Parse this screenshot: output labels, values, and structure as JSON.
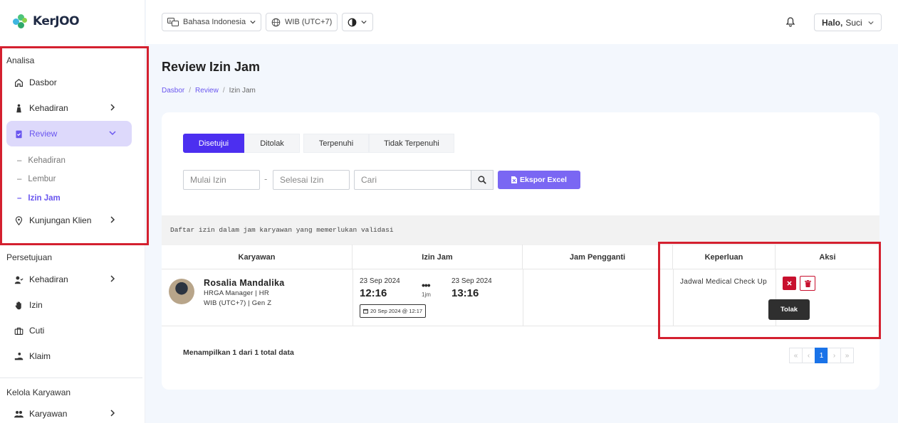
{
  "brand": {
    "logo_text": "KerJOO"
  },
  "sidebar": {
    "analisa_title": "Analisa",
    "dasbor": "Dasbor",
    "kehadiran": "Kehadiran",
    "review": "Review",
    "review_sub": [
      "Kehadiran",
      "Lembur",
      "Izin Jam"
    ],
    "kunjungan": "Kunjungan Klien",
    "persetujuan_title": "Persetujuan",
    "p_kehadiran": "Kehadiran",
    "p_izin": "Izin",
    "p_cuti": "Cuti",
    "p_klaim": "Klaim",
    "kelola_title": "Kelola Karyawan",
    "k_karyawan": "Karyawan"
  },
  "topbar": {
    "language": "Bahasa Indonesia",
    "timezone": "WIB (UTC+7)",
    "greeting": "Halo,",
    "user": "Suci"
  },
  "page": {
    "title": "Review Izin Jam",
    "breadcrumb": [
      "Dasbor",
      "Review",
      "Izin Jam"
    ]
  },
  "tabs": [
    "Disetujui",
    "Ditolak",
    "Terpenuhi",
    "Tidak Terpenuhi"
  ],
  "filters": {
    "start_placeholder": "Mulai Izin",
    "end_placeholder": "Selesai Izin",
    "search_placeholder": "Cari",
    "dash": "-",
    "export_label": "Ekspor Excel"
  },
  "info_text": "Daftar izin dalam jam karyawan yang memerlukan validasi",
  "table": {
    "headers": [
      "Karyawan",
      "Izin Jam",
      "Jam Pengganti",
      "Keperluan",
      "Aksi"
    ],
    "row": {
      "name": "Rosalia Mandalika",
      "position": "HRGA Manager | HR",
      "timezone_gen": "WIB (UTC+7) | Gen Z",
      "start_date": "23 Sep 2024",
      "start_time": "12:16",
      "end_date": "23 Sep 2024",
      "end_time": "13:16",
      "dots": "•••",
      "duration": "1jm",
      "created": "20 Sep 2024 @ 12:17",
      "purpose": "Jadwal Medical Check Up",
      "reject_tooltip": "Tolak"
    }
  },
  "summary": "Menampilkan 1 dari 1 total data",
  "pagination": {
    "first": "«",
    "prev": "‹",
    "current": "1",
    "next": "›",
    "last": "»"
  },
  "colors": {
    "accent": "#4c2ff0",
    "highlight_box": "#d4202f",
    "danger": "#c8102e"
  }
}
